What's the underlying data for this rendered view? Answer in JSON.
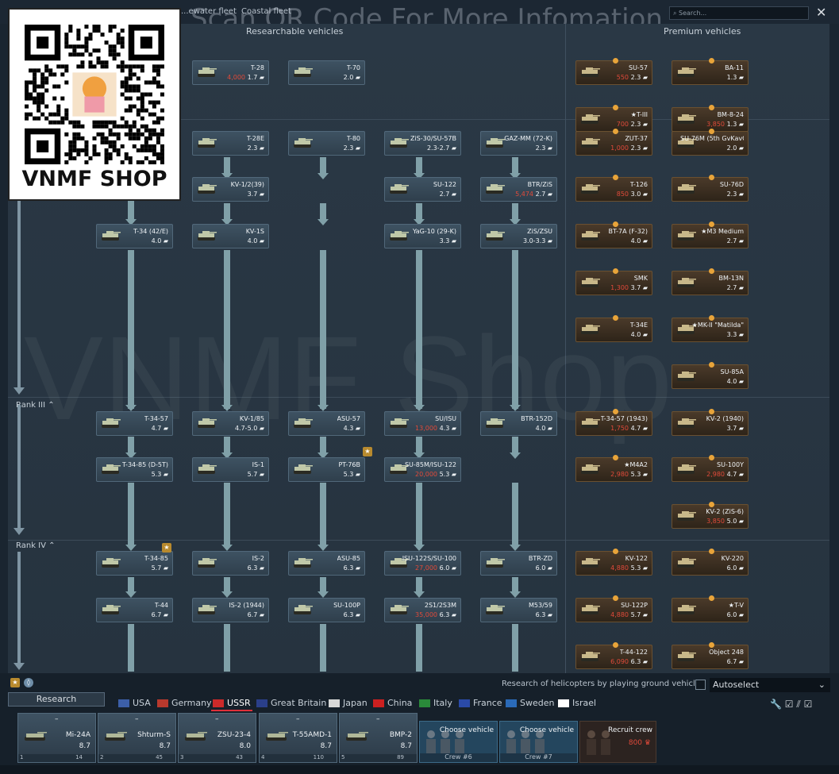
{
  "top_tabs": [
    "...ewater fleet",
    "Coastal fleet"
  ],
  "overlay_text": "Scan QR Code For More Infomation",
  "search_placeholder": "Search...",
  "headers": {
    "researchable": "Researchable vehicles",
    "premium": "Premium vehicles"
  },
  "ranks": [
    "Rank III",
    "Rank IV"
  ],
  "watermark": "VNMF Shop",
  "qr_label": "VNMF SHOP",
  "research_vehicles": [
    {
      "name": "T-28",
      "br": "1.7",
      "cost": "4,000"
    },
    {
      "name": "T-70",
      "br": "2.0"
    },
    {
      "name": "T-28E",
      "br": "2.3"
    },
    {
      "name": "T-80",
      "br": "2.3"
    },
    {
      "name": "ZiS-30/SU-57B",
      "br": "2.3-2.7"
    },
    {
      "name": "GAZ-MM (72-K)",
      "br": "2.3"
    },
    {
      "name": "KV-1/2(39)",
      "br": "3.7"
    },
    {
      "name": "SU-122",
      "br": "2.7"
    },
    {
      "name": "BTR/ZiS",
      "br": "2.7",
      "cost": "5,474"
    },
    {
      "name": "T-34 (42/E)",
      "br": "4.0"
    },
    {
      "name": "KV-1S",
      "br": "4.0"
    },
    {
      "name": "YaG-10 (29-K)",
      "br": "3.3"
    },
    {
      "name": "ZiS/ZSU",
      "br": "3.0-3.3"
    },
    {
      "name": "T-34-57",
      "br": "4.7"
    },
    {
      "name": "KV-1/85",
      "br": "4.7-5.0"
    },
    {
      "name": "ASU-57",
      "br": "4.3"
    },
    {
      "name": "SU/ISU",
      "br": "4.3",
      "cost": "13,000"
    },
    {
      "name": "BTR-152D",
      "br": "4.0"
    },
    {
      "name": "T-34-85 (D-5T)",
      "br": "5.3"
    },
    {
      "name": "IS-1",
      "br": "5.7"
    },
    {
      "name": "PT-76B",
      "br": "5.3"
    },
    {
      "name": "SU-85M/ISU-122",
      "br": "5.3",
      "cost": "20,000"
    },
    {
      "name": "T-34-85",
      "br": "5.7"
    },
    {
      "name": "IS-2",
      "br": "6.3"
    },
    {
      "name": "ASU-85",
      "br": "6.3"
    },
    {
      "name": "ISU-122S/SU-100",
      "br": "6.0",
      "cost": "27,000"
    },
    {
      "name": "BTR-ZD",
      "br": "6.0"
    },
    {
      "name": "T-44",
      "br": "6.7"
    },
    {
      "name": "IS-2 (1944)",
      "br": "6.7"
    },
    {
      "name": "SU-100P",
      "br": "6.3"
    },
    {
      "name": "2S1/2S3M",
      "br": "6.3",
      "cost": "35,000"
    },
    {
      "name": "M53/59",
      "br": "6.3"
    }
  ],
  "premium_vehicles": [
    {
      "name": "SU-57",
      "br": "2.3",
      "cost": "550"
    },
    {
      "name": "BA-11",
      "br": "1.3"
    },
    {
      "name": "★T-III",
      "br": "2.3",
      "cost": "700"
    },
    {
      "name": "BM-8-24",
      "br": "1.3",
      "cost": "3,850"
    },
    {
      "name": "ZUT-37",
      "br": "2.3",
      "cost": "1,000"
    },
    {
      "name": "SU-76M (5th GvKavCorp)",
      "br": "2.0"
    },
    {
      "name": "T-126",
      "br": "3.0",
      "cost": "850"
    },
    {
      "name": "SU-76D",
      "br": "2.3"
    },
    {
      "name": "BT-7A (F-32)",
      "br": "4.0"
    },
    {
      "name": "★M3 Medium",
      "br": "2.7"
    },
    {
      "name": "SMK",
      "br": "3.7",
      "cost": "1,300"
    },
    {
      "name": "BM-13N",
      "br": "2.7"
    },
    {
      "name": "T-34E",
      "br": "4.0"
    },
    {
      "name": "★MK-II \"Matilda\"",
      "br": "3.3"
    },
    {
      "name": "SU-85A",
      "br": "4.0"
    },
    {
      "name": "T-34-57 (1943)",
      "br": "4.7",
      "cost": "1,750"
    },
    {
      "name": "KV-2 (1940)",
      "br": "3.7"
    },
    {
      "name": "★M4A2",
      "br": "5.3",
      "cost": "2,980"
    },
    {
      "name": "SU-100Y",
      "br": "4.7",
      "cost": "2,980"
    },
    {
      "name": "KV-2 (ZiS-6)",
      "br": "5.0",
      "cost": "3,850"
    },
    {
      "name": "KV-122",
      "br": "5.3",
      "cost": "4,880"
    },
    {
      "name": "KV-220",
      "br": "6.0"
    },
    {
      "name": "SU-122P",
      "br": "5.7",
      "cost": "4,880"
    },
    {
      "name": "★T-V",
      "br": "6.0"
    },
    {
      "name": "T-44-122",
      "br": "6.3",
      "cost": "6,090"
    },
    {
      "name": "Object 248",
      "br": "6.7"
    }
  ],
  "bottom": {
    "research_label": "Research",
    "heli_text": "Research of helicopters by playing ground vehicles",
    "autoselect": "Autoselect",
    "nations": [
      "USA",
      "Germany",
      "USSR",
      "Great Britain",
      "Japan",
      "China",
      "Italy",
      "France",
      "Sweden",
      "Israel"
    ],
    "crew": [
      {
        "name": "Mi-24A",
        "br": "8.7",
        "slot": "1",
        "num": "14"
      },
      {
        "name": "Shturm-S",
        "br": "8.7",
        "slot": "2",
        "num": "45"
      },
      {
        "name": "ZSU-23-4",
        "br": "8.0",
        "slot": "3",
        "num": "43"
      },
      {
        "name": "T-55AMD-1",
        "br": "8.7",
        "slot": "4",
        "num": "110"
      },
      {
        "name": "BMP-2",
        "br": "8.7",
        "slot": "5",
        "num": "89"
      }
    ],
    "choose": [
      {
        "label": "Choose vehicle",
        "foot": "Crew #6"
      },
      {
        "label": "Choose vehicle",
        "foot": "Crew #7"
      }
    ],
    "recruit": {
      "label": "Recruit crew",
      "cost": "800"
    }
  }
}
